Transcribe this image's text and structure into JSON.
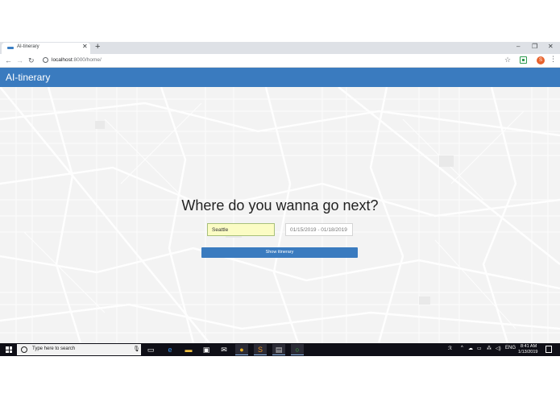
{
  "browser": {
    "tab_title": "AI-tinerary",
    "tab_close": "✕",
    "new_tab": "+",
    "url_host": "localhost",
    "url_path": ":8000/home/",
    "window": {
      "minimize": "–",
      "maximize": "❐",
      "close": "✕"
    },
    "profile_initial": "S"
  },
  "header": {
    "brand": "AI-tinerary"
  },
  "search": {
    "headline": "Where do you wanna go next?",
    "city_value": "Seattle",
    "date_value": "01/15/2019 - 01/18/2019",
    "button_label": "Show itinerary"
  },
  "taskbar": {
    "search_placeholder": "Type here to search",
    "language": "ENG",
    "time": "8:41 AM",
    "date": "1/13/2019"
  },
  "colors": {
    "accent": "#3a7bbf",
    "city_input_bg": "#fbfcc4",
    "taskbar": "#0f0f17"
  }
}
